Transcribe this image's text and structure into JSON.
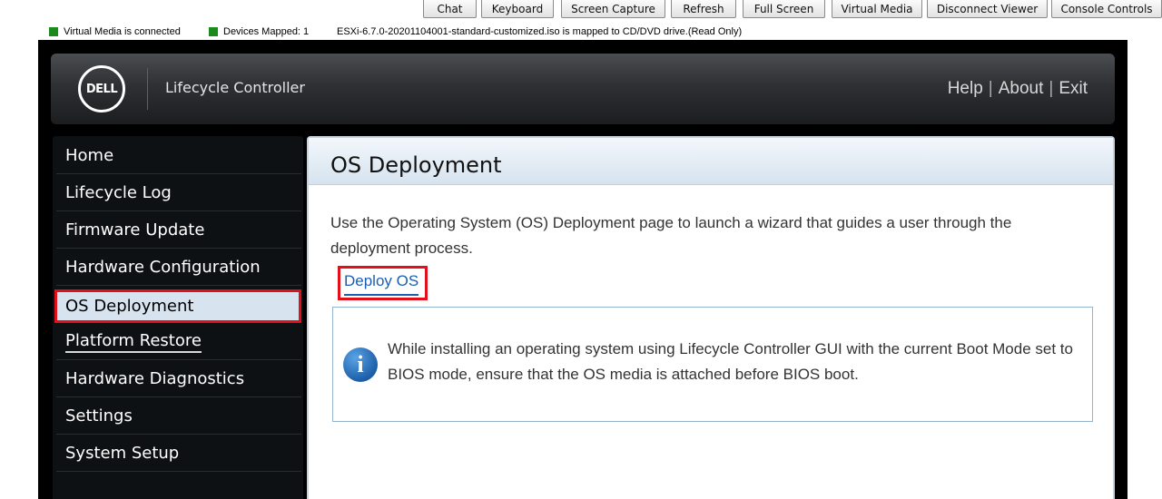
{
  "viewer_toolbar": {
    "buttons": [
      "Chat",
      "Keyboard",
      "Screen Capture",
      "Refresh",
      "Full Screen",
      "Virtual Media",
      "Disconnect Viewer",
      "Console Controls"
    ]
  },
  "status": {
    "virtual_media": "Virtual Media is connected",
    "devices_mapped": "Devices Mapped: 1",
    "iso_message": "ESXi-6.7.0-20201104001-standard-customized.iso is mapped to CD/DVD drive.(Read Only)",
    "indicator_color": "#1a8a1a"
  },
  "header": {
    "logo_text": "DELL",
    "app_title": "Lifecycle Controller",
    "links": [
      "Help",
      "About",
      "Exit"
    ],
    "separator": "|"
  },
  "sidebar": {
    "items": [
      {
        "label": "Home"
      },
      {
        "label": "Lifecycle Log"
      },
      {
        "label": "Firmware Update"
      },
      {
        "label": "Hardware Configuration"
      },
      {
        "label": "OS Deployment",
        "active": true
      },
      {
        "label": "Platform Restore"
      },
      {
        "label": "Hardware Diagnostics"
      },
      {
        "label": "Settings"
      },
      {
        "label": "System Setup"
      }
    ]
  },
  "main": {
    "title": "OS Deployment",
    "description": "Use the Operating System (OS) Deployment page to launch a wizard that guides a user through the deployment process.",
    "deploy_link": "Deploy OS",
    "info_icon_glyph": "i",
    "info_text": "While installing an operating system using Lifecycle Controller GUI with the current Boot Mode set to BIOS mode, ensure that the OS media is attached before BIOS boot."
  },
  "colors": {
    "highlight_red": "#e1101a",
    "link_blue": "#1a5fb4",
    "active_nav_bg": "#d7e3ef"
  }
}
